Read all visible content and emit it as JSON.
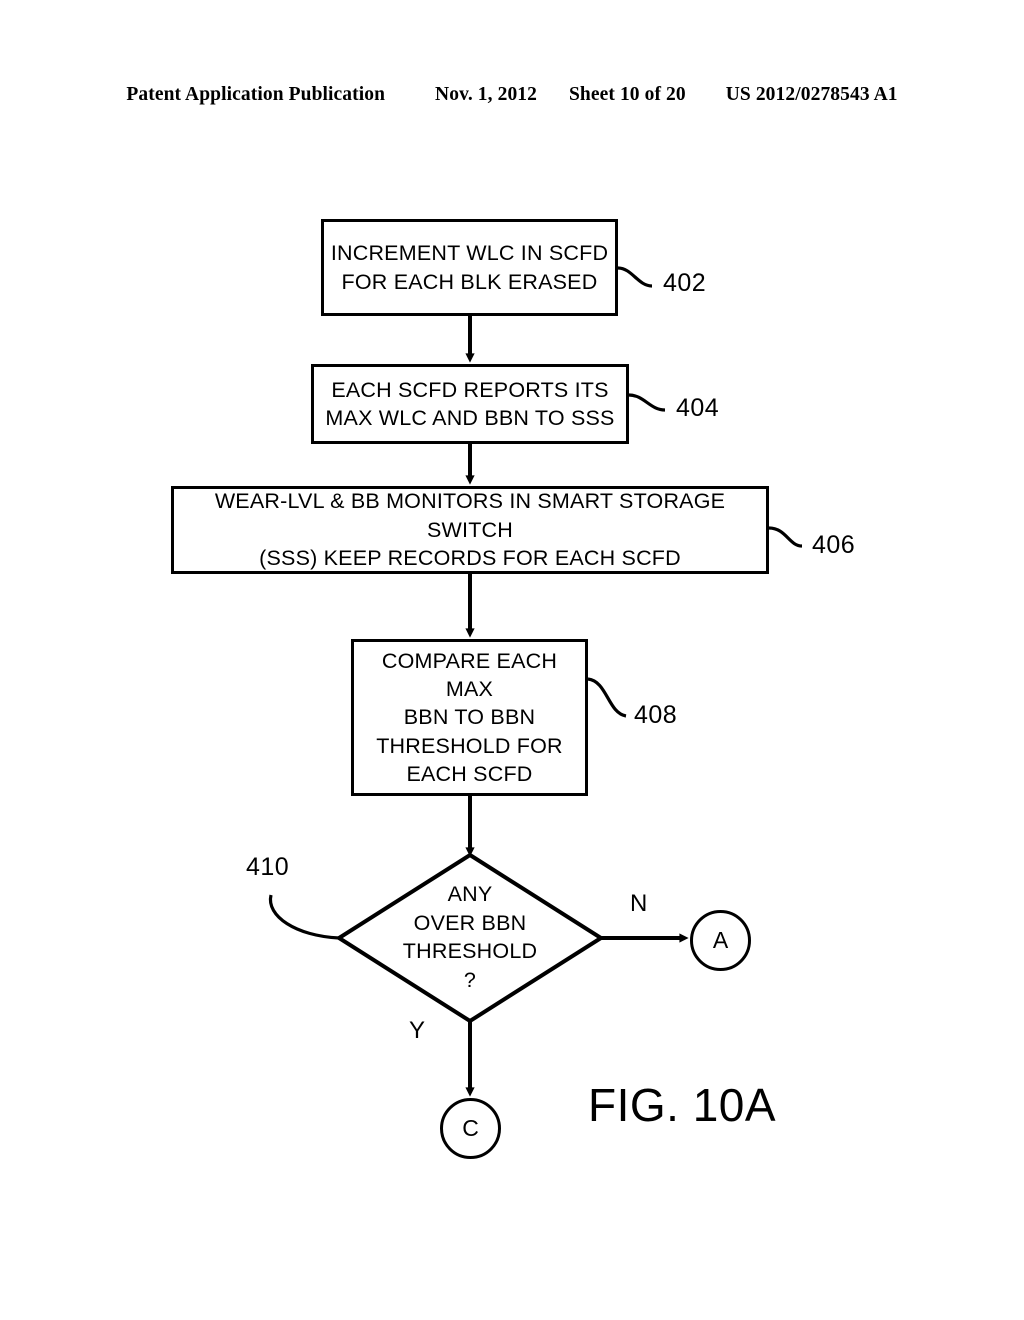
{
  "header": {
    "publication": "Patent Application Publication",
    "date": "Nov. 1, 2012",
    "sheet": "Sheet 10 of 20",
    "patent_number": "US 2012/0278543 A1"
  },
  "figure": {
    "caption": "FIG. 10A",
    "type": "flowchart",
    "ink_color": "#000000",
    "background_color": "#ffffff"
  },
  "flowchart": {
    "nodes": [
      {
        "id": "402",
        "shape": "process-box",
        "line1": "INCREMENT WLC IN SCFD",
        "line2": "FOR EACH BLK ERASED",
        "ref": "402"
      },
      {
        "id": "404",
        "shape": "process-box",
        "line1": "EACH SCFD REPORTS ITS",
        "line2": "MAX WLC AND BBN TO SSS",
        "ref": "404"
      },
      {
        "id": "406",
        "shape": "process-box",
        "line1": "WEAR-LVL & BB MONITORS IN SMART STORAGE SWITCH",
        "line2": "(SSS) KEEP RECORDS FOR EACH SCFD",
        "ref": "406"
      },
      {
        "id": "408",
        "shape": "process-box",
        "line1": "COMPARE EACH MAX",
        "line2": "BBN TO BBN",
        "line3": "THRESHOLD FOR",
        "line4": "EACH SCFD",
        "ref": "408"
      },
      {
        "id": "410",
        "shape": "decision-diamond",
        "line1": "ANY",
        "line2": "OVER BBN",
        "line3": "THRESHOLD",
        "line4": "?",
        "ref": "410"
      }
    ],
    "branches": {
      "no_label": "N",
      "yes_label": "Y"
    },
    "connectors": [
      {
        "id": "A",
        "label": "A",
        "from": "410",
        "branch": "N"
      },
      {
        "id": "C",
        "label": "C",
        "from": "410",
        "branch": "Y"
      }
    ]
  }
}
